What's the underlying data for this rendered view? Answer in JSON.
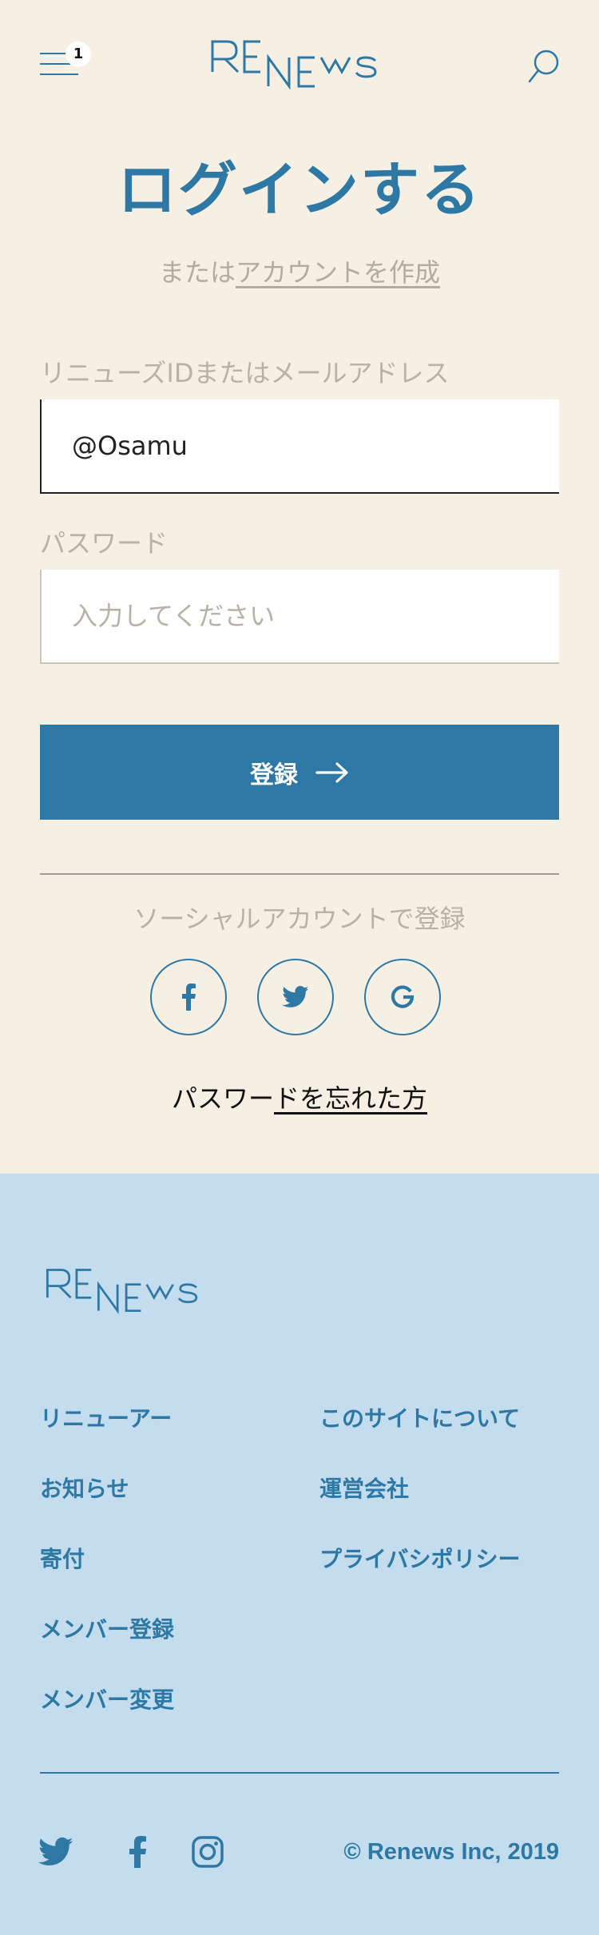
{
  "header": {
    "menu_badge": "1",
    "logo_text": "RENEWS"
  },
  "login": {
    "title": "ログインする",
    "subline_prefix": "または",
    "subline_link": "アカウントを作成",
    "id_label": "リニューズIDまたはメールアドレス",
    "id_value": "@Osamu",
    "password_label": "パスワード",
    "password_placeholder": "入力してください",
    "submit_label": "登録",
    "social_label": "ソーシャルアカウントで登録",
    "social_icons": [
      "facebook-icon",
      "twitter-icon",
      "google-icon"
    ],
    "forgot_prefix": "パスワー",
    "forgot_link": "ドを忘れた方"
  },
  "footer": {
    "logo_text": "RENEWS",
    "links_left": [
      "リニューアー",
      "お知らせ",
      "寄付",
      "メンバー登録",
      "メンバー変更"
    ],
    "links_right": [
      "このサイトについて",
      "運営会社",
      "プライバシポリシー"
    ],
    "social_icons": [
      "twitter-icon",
      "facebook-icon",
      "instagram-icon"
    ],
    "copyright": "© Renews Inc, 2019"
  },
  "colors": {
    "brand_blue": "#2e78a6",
    "top_background": "#f5f0e3",
    "footer_background": "#c3dcee",
    "muted_text": "#b6b2a8"
  }
}
